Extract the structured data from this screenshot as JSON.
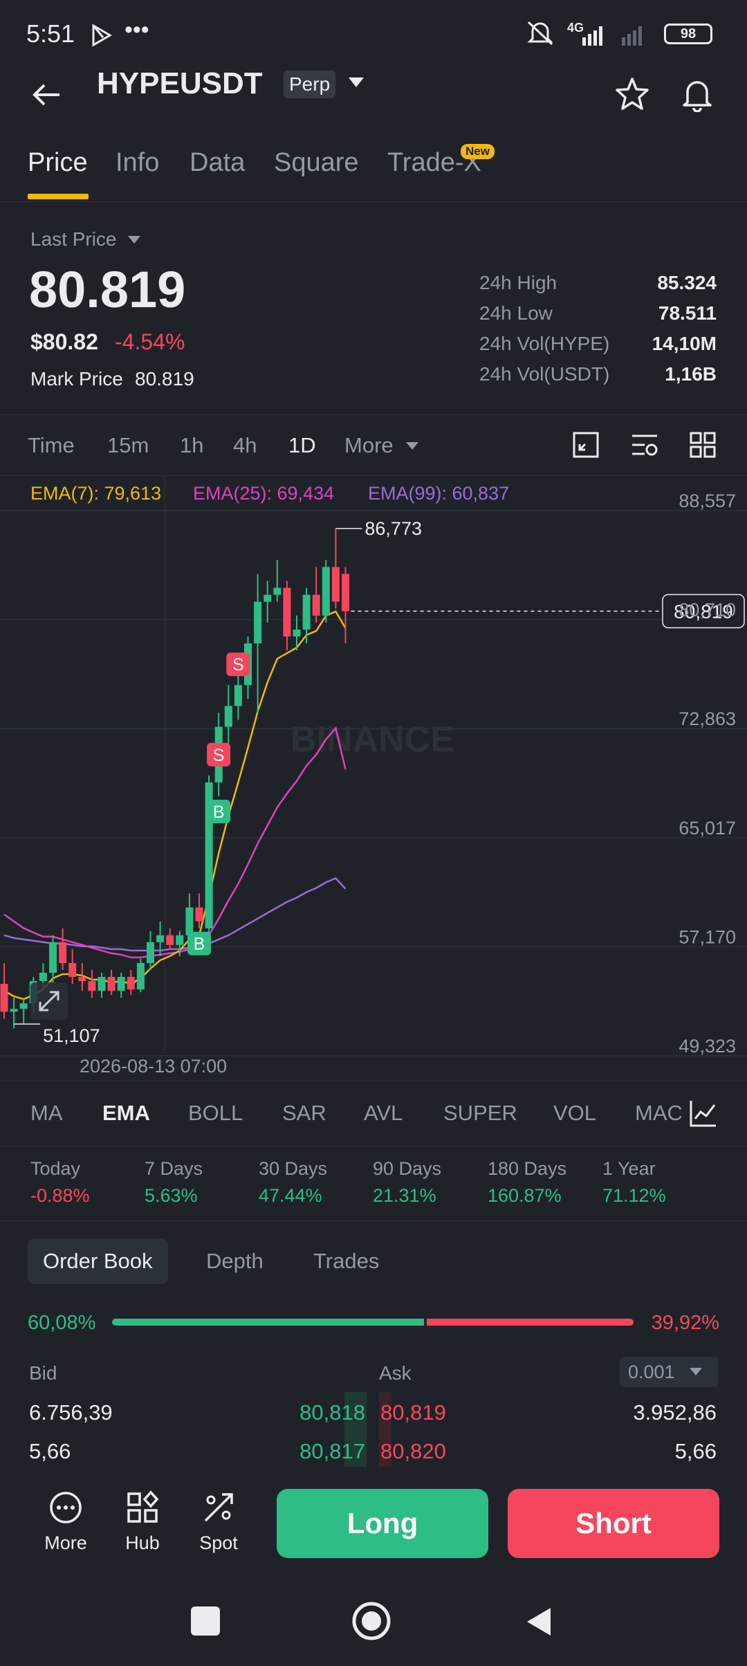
{
  "status_bar": {
    "time": "5:51",
    "network": "4G",
    "battery": "98"
  },
  "header": {
    "title": "HYPEUSDT",
    "badge": "Perp"
  },
  "tabs": [
    {
      "label": "Price"
    },
    {
      "label": "Info"
    },
    {
      "label": "Data"
    },
    {
      "label": "Square"
    },
    {
      "label": "Trade-X"
    }
  ],
  "new_badge": "New",
  "price": {
    "last_price_label": "Last Price",
    "last_price": "80.819",
    "fiat_price": "$80.82",
    "change_pct": "-4.54%",
    "mark_price_label": "Mark Price",
    "mark_price": "80.819"
  },
  "stats": [
    {
      "label": "24h High",
      "value": "85.324"
    },
    {
      "label": "24h Low",
      "value": "78.511"
    },
    {
      "label": "24h Vol(HYPE)",
      "value": "14,10M"
    },
    {
      "label": "24h Vol(USDT)",
      "value": "1,16B"
    }
  ],
  "timeframes": [
    "Time",
    "15m",
    "1h",
    "4h",
    "1D",
    "More"
  ],
  "ema_legend": {
    "ema7": "EMA(7): 79,613",
    "ema25": "EMA(25): 69,434",
    "ema99": "EMA(99): 60,837"
  },
  "chart_data": {
    "type": "candlestick",
    "y_axis_labels": [
      "88,557",
      "80,710",
      "72,863",
      "65,017",
      "57,170",
      "49,323"
    ],
    "ylim": [
      49.323,
      88.557
    ],
    "current_price_label": "80,819",
    "current_price": 80.819,
    "high_marker": "86,773",
    "high_value": 86.773,
    "low_marker": "51,107",
    "low_value": 51.107,
    "date_label": "2026-08-13 07:00",
    "watermark": "BINANCE",
    "candles": [
      [
        54.0,
        55.5,
        51.5,
        52.0
      ],
      [
        52.0,
        53.0,
        50.8,
        52.2
      ],
      [
        52.2,
        53.0,
        51.1,
        52.6
      ],
      [
        52.6,
        54.5,
        52.0,
        54.2
      ],
      [
        54.2,
        55.5,
        53.5,
        54.8
      ],
      [
        54.8,
        57.5,
        54.0,
        57.0
      ],
      [
        57.0,
        58.0,
        55.0,
        55.5
      ],
      [
        55.5,
        56.5,
        54.0,
        54.5
      ],
      [
        54.5,
        55.5,
        53.5,
        54.2
      ],
      [
        54.2,
        55.0,
        53.0,
        53.5
      ],
      [
        53.5,
        54.8,
        53.0,
        54.5
      ],
      [
        54.5,
        55.0,
        53.2,
        53.5
      ],
      [
        53.5,
        54.8,
        53.0,
        54.5
      ],
      [
        54.5,
        55.0,
        53.2,
        53.6
      ],
      [
        53.6,
        55.8,
        53.4,
        55.5
      ],
      [
        55.5,
        57.8,
        55.0,
        57.0
      ],
      [
        57.0,
        58.5,
        56.0,
        57.5
      ],
      [
        57.5,
        58.0,
        56.5,
        56.8
      ],
      [
        56.8,
        57.8,
        56.0,
        57.5
      ],
      [
        57.5,
        60.5,
        57.0,
        59.5
      ],
      [
        59.5,
        60.5,
        58.0,
        58.5
      ],
      [
        58.0,
        69.0,
        57.5,
        68.5
      ],
      [
        68.5,
        73.5,
        67.5,
        72.5
      ],
      [
        72.5,
        75.5,
        71.0,
        74.0
      ],
      [
        74.0,
        76.5,
        73.0,
        75.5
      ],
      [
        75.5,
        79.0,
        74.5,
        78.5
      ],
      [
        78.5,
        83.5,
        73.5,
        81.5
      ],
      [
        81.5,
        83.0,
        80.0,
        82.0
      ],
      [
        82.0,
        84.5,
        81.5,
        82.5
      ],
      [
        82.5,
        83.0,
        78.0,
        79.0
      ],
      [
        79.0,
        80.5,
        78.0,
        79.5
      ],
      [
        79.5,
        82.5,
        78.5,
        82.0
      ],
      [
        82.0,
        84.0,
        80.0,
        80.5
      ],
      [
        80.5,
        84.5,
        80.0,
        84.0
      ],
      [
        84.0,
        86.773,
        81.0,
        81.5
      ],
      [
        83.5,
        84.0,
        78.5,
        80.819
      ]
    ],
    "ema7": [
      53.5,
      53.1,
      52.9,
      53.2,
      53.6,
      54.4,
      54.7,
      54.7,
      54.6,
      54.3,
      54.3,
      54.1,
      54.2,
      54.0,
      54.4,
      55.1,
      55.7,
      56.0,
      56.4,
      57.2,
      57.5,
      60.3,
      63.4,
      66.1,
      68.5,
      71.0,
      73.6,
      75.7,
      77.4,
      77.8,
      78.2,
      79.1,
      79.4,
      80.5,
      80.8,
      79.6
    ],
    "ema25": [
      59.0,
      58.5,
      58.0,
      57.7,
      57.4,
      57.4,
      57.2,
      57.0,
      56.8,
      56.6,
      56.4,
      56.2,
      56.1,
      55.9,
      55.9,
      56.0,
      56.1,
      56.2,
      56.3,
      56.5,
      56.6,
      57.5,
      58.7,
      60.0,
      61.2,
      62.6,
      64.1,
      65.4,
      66.7,
      67.7,
      68.6,
      69.7,
      70.5,
      71.6,
      72.4,
      69.434
    ],
    "ema99": [
      57.5,
      57.3,
      57.2,
      57.1,
      57.0,
      56.9,
      56.9,
      56.8,
      56.7,
      56.7,
      56.6,
      56.5,
      56.5,
      56.4,
      56.4,
      56.4,
      56.4,
      56.5,
      56.5,
      56.6,
      56.6,
      56.9,
      57.2,
      57.5,
      57.9,
      58.3,
      58.7,
      59.1,
      59.5,
      59.9,
      60.2,
      60.6,
      60.9,
      61.3,
      61.6,
      60.837
    ],
    "signals": [
      {
        "label": "S",
        "candle": 23
      },
      {
        "label": "S",
        "candle": 21
      },
      {
        "label": "B",
        "candle": 22
      },
      {
        "label": "B",
        "candle": 20
      }
    ],
    "colors": {
      "up": "#2ebd85",
      "down": "#f6465d",
      "ema7": "#f0b90b",
      "ema25": "#e040c0",
      "ema99": "#9b6bd6"
    }
  },
  "indicators": [
    "MA",
    "EMA",
    "BOLL",
    "SAR",
    "AVL",
    "SUPER",
    "VOL",
    "MACD"
  ],
  "performance": [
    {
      "label": "Today",
      "value": "-0.88%"
    },
    {
      "label": "7 Days",
      "value": "5.63%"
    },
    {
      "label": "30 Days",
      "value": "47.44%"
    },
    {
      "label": "90 Days",
      "value": "21.31%"
    },
    {
      "label": "180 Days",
      "value": "160.87%"
    },
    {
      "label": "1 Year",
      "value": "71.12%"
    }
  ],
  "order_book": {
    "tabs": [
      "Order Book",
      "Depth",
      "Trades"
    ],
    "bid_ratio": "60,08%",
    "bid_ratio_value": 60.08,
    "ask_ratio": "39,92%",
    "bid_label": "Bid",
    "ask_label": "Ask",
    "precision": "0.001",
    "rows": [
      {
        "bid_qty": "6.756,39",
        "bid_price": "80,818",
        "ask_price": "80,819",
        "ask_qty": "3.952,86"
      },
      {
        "bid_qty": "5,66",
        "bid_price": "80,817",
        "ask_price": "80,820",
        "ask_qty": "5,66"
      }
    ]
  },
  "actions": {
    "more": "More",
    "hub": "Hub",
    "spot": "Spot",
    "long": "Long",
    "short": "Short"
  }
}
